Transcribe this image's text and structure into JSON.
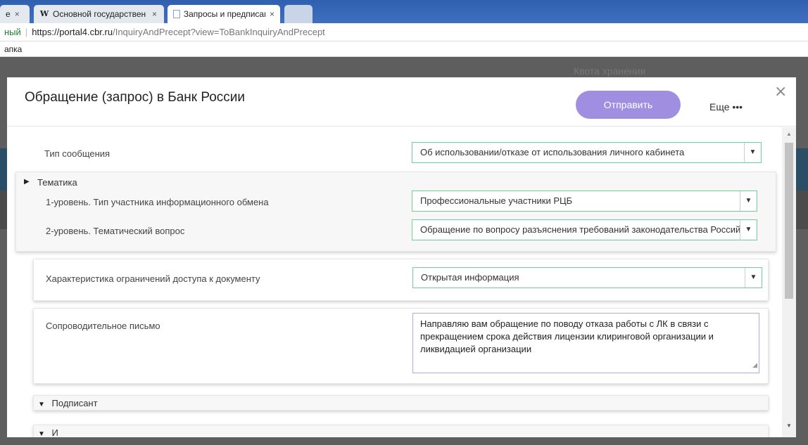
{
  "browser": {
    "tabs": [
      {
        "label": "е",
        "favicon": ""
      },
      {
        "label": "Основной государствен",
        "favicon": "W"
      },
      {
        "label": "Запросы и предписани",
        "favicon": "page-icon"
      }
    ],
    "close_glyph": "×",
    "address": {
      "security_label": "ный",
      "separator": "|",
      "url_host": "https://portal4.cbr.ru",
      "url_path": "/InquiryAndPrecept?view=ToBankInquiryAndPrecept"
    },
    "bookmarks_label": "апка"
  },
  "background_page": {
    "quota_label": "Квота хранения"
  },
  "modal": {
    "title": "Обращение (запрос) в Банк России",
    "send_label": "Отправить",
    "more_label": "Еще •••",
    "close_glyph": "×",
    "message_type": {
      "label": "Тип сообщения",
      "value": "Об использовании/отказе от использования личного кабинета"
    },
    "topic_section": {
      "title": "Тематика",
      "level1": {
        "label": "1-уровень. Тип участника информационного обмена",
        "value": "Профессиональные участники РЦБ"
      },
      "level2": {
        "label": "2-уровень. Тематический вопрос",
        "value": "Обращение по вопросу разъяснения требований законодательства Российс"
      }
    },
    "access": {
      "label": "Характеристика ограничений доступа к документу",
      "value": "Открытая информация"
    },
    "cover_letter": {
      "label": "Сопроводительное письмо",
      "value": "Направляю вам обращение по поводу отказа работы с ЛК в связи с прекращением срока действия лицензии клиринговой организации и ликвидацией организации"
    },
    "signer_section": {
      "title": "Подписант"
    },
    "next_section": {
      "title": "И"
    }
  },
  "icons": {
    "dropdown": "▼",
    "expand": "▶",
    "collapse": "▼",
    "scroll_up": "▲",
    "scroll_down": "▼",
    "resize": "◢"
  },
  "colors": {
    "accent_button": "#a08fe0",
    "select_border": "#6fcf9a",
    "textarea_border": "#b6a8e8"
  }
}
